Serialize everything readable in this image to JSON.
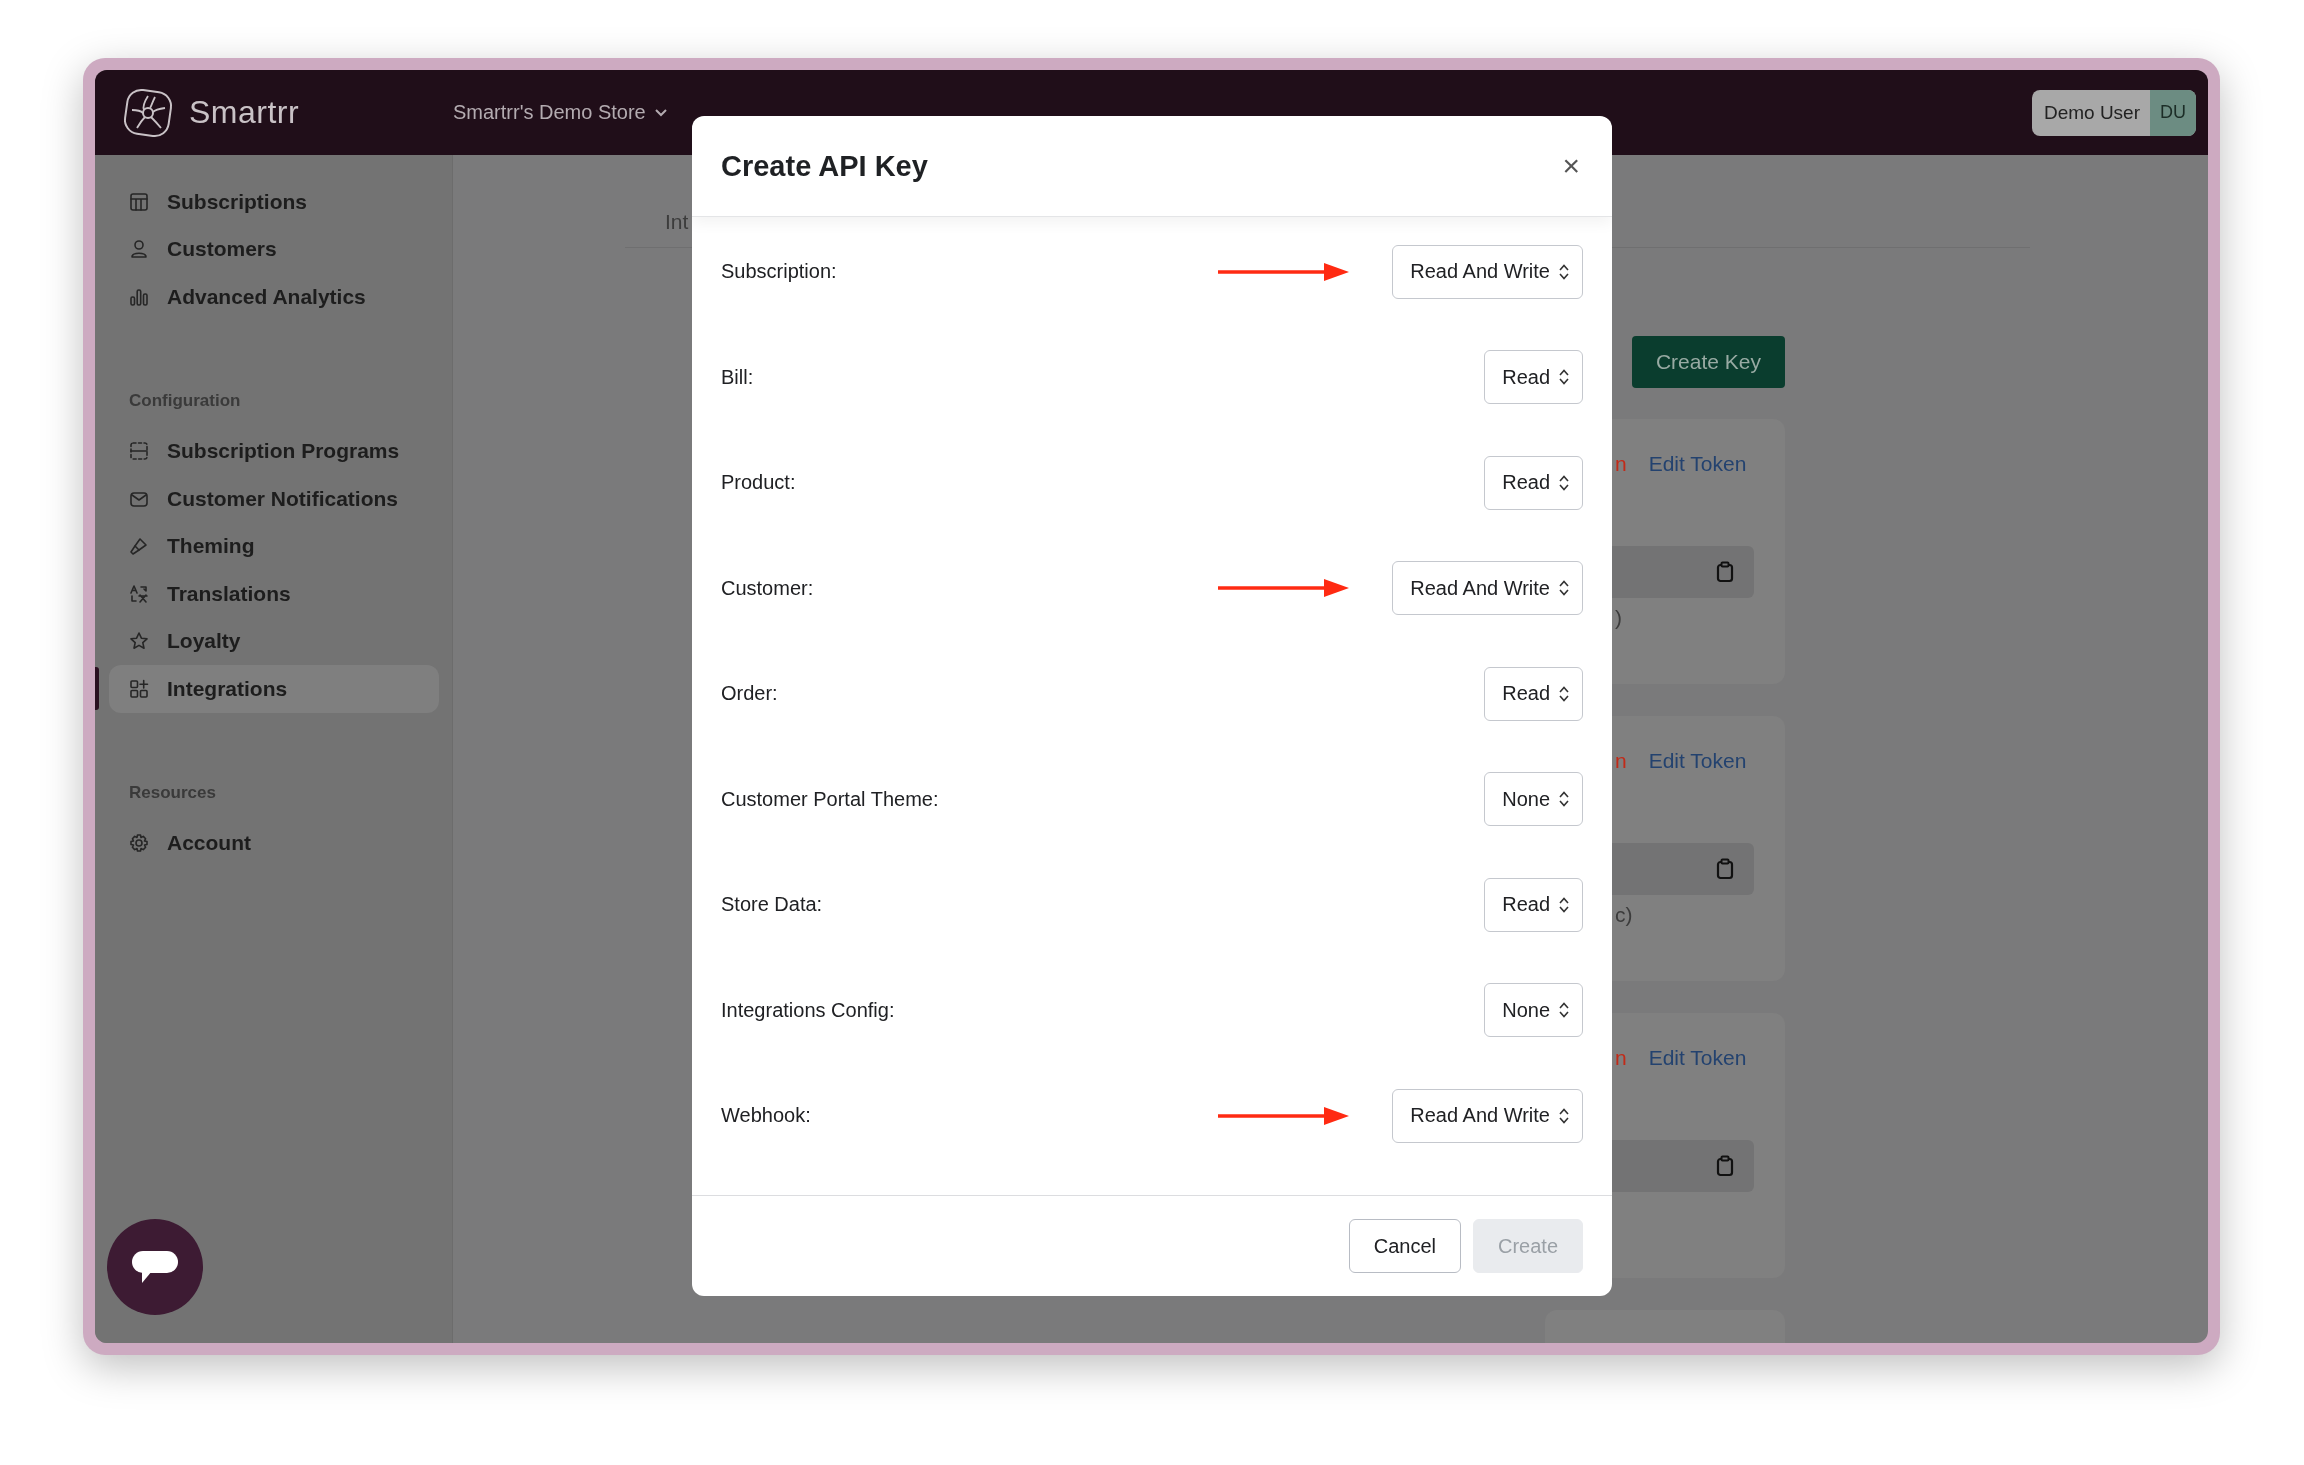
{
  "app": {
    "brand": "Smartrr",
    "store_selector": "Smartrr's Demo Store",
    "user": {
      "name": "Demo User",
      "initials": "DU"
    }
  },
  "sidebar": {
    "sections": [
      {
        "items": [
          {
            "label": "Subscriptions",
            "kind": "table",
            "selected": false
          },
          {
            "label": "Customers",
            "kind": "person",
            "selected": false
          },
          {
            "label": "Advanced Analytics",
            "kind": "bars",
            "selected": false
          }
        ]
      },
      {
        "heading": "Configuration",
        "items": [
          {
            "label": "Subscription Programs",
            "kind": "dashed",
            "selected": false
          },
          {
            "label": "Customer Notifications",
            "kind": "mail",
            "selected": false
          },
          {
            "label": "Theming",
            "kind": "brush",
            "selected": false
          },
          {
            "label": "Translations",
            "kind": "translate",
            "selected": false
          },
          {
            "label": "Loyalty",
            "kind": "star",
            "selected": false
          },
          {
            "label": "Integrations",
            "kind": "apps",
            "selected": true
          }
        ]
      },
      {
        "heading": "Resources",
        "items": [
          {
            "label": "Account",
            "kind": "gear",
            "selected": false
          }
        ]
      }
    ]
  },
  "background": {
    "tab": "Int",
    "create_button": "Create Key",
    "cards": [
      {
        "fragment": "n",
        "link": "Edit Token",
        "copy_field": true,
        "note": ")"
      },
      {
        "fragment": "n",
        "link": "Edit Token",
        "copy_field": true,
        "note": "c)"
      },
      {
        "fragment": "n",
        "link": "Edit Token",
        "copy_field": true
      },
      {
        "copy_field": false
      }
    ]
  },
  "modal": {
    "title": "Create API Key",
    "close": "×",
    "permissions": [
      {
        "label": "Subscription:",
        "value": "Read And Write",
        "marked": true
      },
      {
        "label": "Bill:",
        "value": "Read",
        "marked": false
      },
      {
        "label": "Product:",
        "value": "Read",
        "marked": false
      },
      {
        "label": "Customer:",
        "value": "Read And Write",
        "marked": true
      },
      {
        "label": "Order:",
        "value": "Read",
        "marked": false
      },
      {
        "label": "Customer Portal Theme:",
        "value": "None",
        "marked": false
      },
      {
        "label": "Store Data:",
        "value": "Read",
        "marked": false
      },
      {
        "label": "Integrations Config:",
        "value": "None",
        "marked": false
      },
      {
        "label": "Webhook:",
        "value": "Read And Write",
        "marked": true
      }
    ],
    "buttons": [
      {
        "label": "Cancel",
        "disabled": false
      },
      {
        "label": "Create",
        "disabled": true
      }
    ]
  }
}
